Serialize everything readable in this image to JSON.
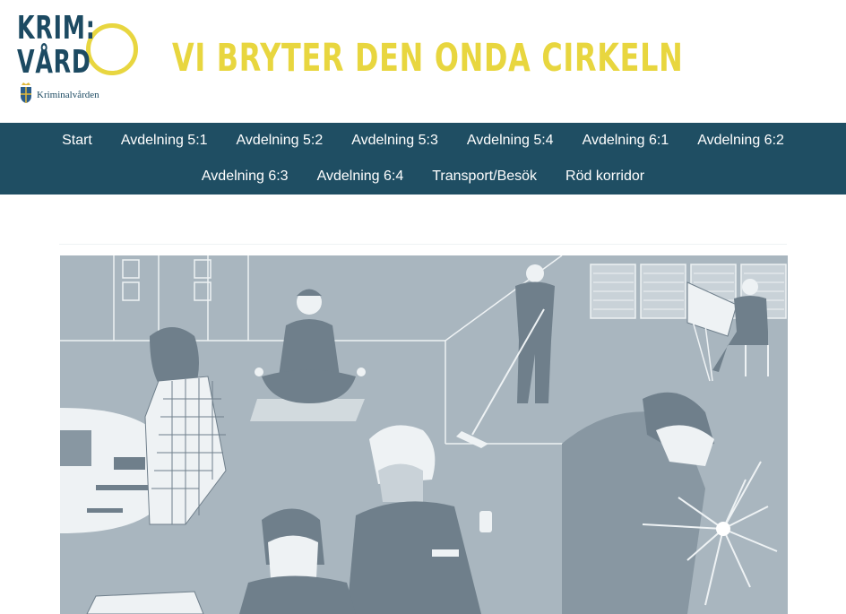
{
  "header": {
    "logo_line1": "KRIM:",
    "logo_line2": "VÅRD",
    "org_name": "Kriminalvården",
    "tagline": "VI BRYTER DEN ONDA CIRKELN"
  },
  "nav": {
    "row1": [
      {
        "label": "Start"
      },
      {
        "label": "Avdelning 5:1"
      },
      {
        "label": "Avdelning 5:2"
      },
      {
        "label": "Avdelning 5:3"
      },
      {
        "label": "Avdelning 5:4"
      },
      {
        "label": "Avdelning 6:1"
      },
      {
        "label": "Avdelning 6:2"
      }
    ],
    "row2": [
      {
        "label": "Avdelning 6:3"
      },
      {
        "label": "Avdelning 6:4"
      },
      {
        "label": "Transport/Besök"
      },
      {
        "label": "Röd korridor"
      }
    ]
  },
  "colors": {
    "brand_navy": "#1f4e63",
    "brand_yellow": "#e8d63f",
    "illustration_bg": "#a9b6bf"
  }
}
